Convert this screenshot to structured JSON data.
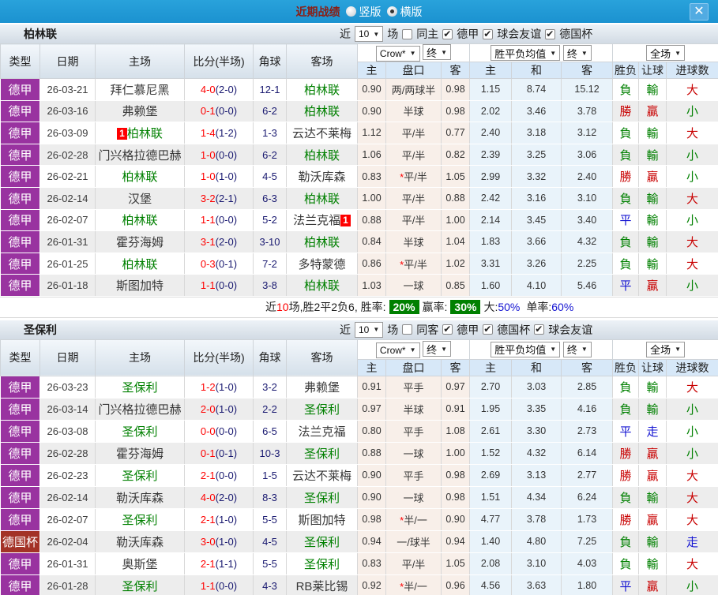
{
  "titlebar": {
    "title": "近期战绩",
    "radio_vertical": "竖版",
    "radio_horizontal": "横版",
    "close_label": "✕"
  },
  "headers": {
    "type": "类型",
    "date": "日期",
    "home": "主场",
    "score": "比分(半场)",
    "corner": "角球",
    "away": "客场",
    "asia_home": "主",
    "handicap": "盘口",
    "asia_away": "客",
    "eu_home": "主",
    "eu_draw": "和",
    "eu_away": "客",
    "result": "胜负",
    "let_ball": "让球",
    "goals": "进球数"
  },
  "dropdowns": {
    "company": "Crow*",
    "final1": "终",
    "avg": "胜平负均值",
    "final2": "终",
    "scope": "全场"
  },
  "sections": [
    {
      "team": "柏林联",
      "near_label": "近",
      "games_count": "10",
      "games_label": "场",
      "same_label": "同主",
      "filters": [
        "德甲",
        "球会友谊",
        "德国杯"
      ],
      "rows": [
        {
          "league": "德甲",
          "date": "26-03-21",
          "home": "拜仁慕尼黑",
          "home_self": false,
          "score": "4-0",
          "half": "(2-0)",
          "corner": "12-1",
          "away": "柏林联",
          "away_self": true,
          "asia_home": "0.90",
          "handicap": "两/两球半",
          "handicap_star": false,
          "asia_away": "0.98",
          "eu_home": "1.15",
          "eu_draw": "8.74",
          "eu_away": "15.12",
          "result": "負",
          "handicap_result": "輸",
          "goals_result": "大"
        },
        {
          "league": "德甲",
          "date": "26-03-16",
          "home": "弗赖堡",
          "home_self": false,
          "score": "0-1",
          "half": "(0-0)",
          "corner": "6-2",
          "away": "柏林联",
          "away_self": true,
          "asia_home": "0.90",
          "handicap": "半球",
          "handicap_star": false,
          "asia_away": "0.98",
          "eu_home": "2.02",
          "eu_draw": "3.46",
          "eu_away": "3.78",
          "result": "勝",
          "handicap_result": "贏",
          "goals_result": "小"
        },
        {
          "league": "德甲",
          "date": "26-03-09",
          "home": "柏林联",
          "home_self": true,
          "home_badge": "1",
          "score": "1-4",
          "half": "(1-2)",
          "corner": "1-3",
          "away": "云达不莱梅",
          "away_self": false,
          "asia_home": "1.12",
          "handicap": "平/半",
          "handicap_star": false,
          "asia_away": "0.77",
          "eu_home": "2.40",
          "eu_draw": "3.18",
          "eu_away": "3.12",
          "result": "負",
          "handicap_result": "輸",
          "goals_result": "大"
        },
        {
          "league": "德甲",
          "date": "26-02-28",
          "home": "门兴格拉德巴赫",
          "home_self": false,
          "score": "1-0",
          "half": "(0-0)",
          "corner": "6-2",
          "away": "柏林联",
          "away_self": true,
          "asia_home": "1.06",
          "handicap": "平/半",
          "handicap_star": false,
          "asia_away": "0.82",
          "eu_home": "2.39",
          "eu_draw": "3.25",
          "eu_away": "3.06",
          "result": "負",
          "handicap_result": "輸",
          "goals_result": "小"
        },
        {
          "league": "德甲",
          "date": "26-02-21",
          "home": "柏林联",
          "home_self": true,
          "score": "1-0",
          "half": "(1-0)",
          "corner": "4-5",
          "away": "勒沃库森",
          "away_self": false,
          "asia_home": "0.83",
          "handicap": "平/半",
          "handicap_star": true,
          "asia_away": "1.05",
          "eu_home": "2.99",
          "eu_draw": "3.32",
          "eu_away": "2.40",
          "result": "勝",
          "handicap_result": "贏",
          "goals_result": "小"
        },
        {
          "league": "德甲",
          "date": "26-02-14",
          "home": "汉堡",
          "home_self": false,
          "score": "3-2",
          "half": "(2-1)",
          "corner": "6-3",
          "away": "柏林联",
          "away_self": true,
          "asia_home": "1.00",
          "handicap": "平/半",
          "handicap_star": false,
          "asia_away": "0.88",
          "eu_home": "2.42",
          "eu_draw": "3.16",
          "eu_away": "3.10",
          "result": "負",
          "handicap_result": "輸",
          "goals_result": "大"
        },
        {
          "league": "德甲",
          "date": "26-02-07",
          "home": "柏林联",
          "home_self": true,
          "score": "1-1",
          "half": "(0-0)",
          "corner": "5-2",
          "away": "法兰克福",
          "away_self": false,
          "away_badge": "1",
          "asia_home": "0.88",
          "handicap": "平/半",
          "handicap_star": false,
          "asia_away": "1.00",
          "eu_home": "2.14",
          "eu_draw": "3.45",
          "eu_away": "3.40",
          "result": "平",
          "handicap_result": "輸",
          "goals_result": "小"
        },
        {
          "league": "德甲",
          "date": "26-01-31",
          "home": "霍芬海姆",
          "home_self": false,
          "score": "3-1",
          "half": "(2-0)",
          "corner": "3-10",
          "away": "柏林联",
          "away_self": true,
          "asia_home": "0.84",
          "handicap": "半球",
          "handicap_star": false,
          "asia_away": "1.04",
          "eu_home": "1.83",
          "eu_draw": "3.66",
          "eu_away": "4.32",
          "result": "負",
          "handicap_result": "輸",
          "goals_result": "大"
        },
        {
          "league": "德甲",
          "date": "26-01-25",
          "home": "柏林联",
          "home_self": true,
          "score": "0-3",
          "half": "(0-1)",
          "corner": "7-2",
          "away": "多特蒙德",
          "away_self": false,
          "asia_home": "0.86",
          "handicap": "平/半",
          "handicap_star": true,
          "asia_away": "1.02",
          "eu_home": "3.31",
          "eu_draw": "3.26",
          "eu_away": "2.25",
          "result": "負",
          "handicap_result": "輸",
          "goals_result": "大"
        },
        {
          "league": "德甲",
          "date": "26-01-18",
          "home": "斯图加特",
          "home_self": false,
          "score": "1-1",
          "half": "(0-0)",
          "corner": "3-8",
          "away": "柏林联",
          "away_self": true,
          "asia_home": "1.03",
          "handicap": "一球",
          "handicap_star": false,
          "asia_away": "0.85",
          "eu_home": "1.60",
          "eu_draw": "4.10",
          "eu_away": "5.46",
          "result": "平",
          "handicap_result": "贏",
          "goals_result": "小"
        }
      ],
      "summary": {
        "near": "近",
        "count": "10",
        "stats": "场,胜2平2负6, 胜率:",
        "win_pct": "20%",
        "win_label": "赢率:",
        "win2_pct": "30%",
        "big_label": "大:",
        "big_pct": "50%",
        "single_label": "单率:",
        "single_pct": "60%"
      }
    },
    {
      "team": "圣保利",
      "near_label": "近",
      "games_count": "10",
      "games_label": "场",
      "same_label": "同客",
      "filters": [
        "德甲",
        "德国杯",
        "球会友谊"
      ],
      "rows": [
        {
          "league": "德甲",
          "date": "26-03-23",
          "home": "圣保利",
          "home_self": true,
          "score": "1-2",
          "half": "(1-0)",
          "corner": "3-2",
          "away": "弗赖堡",
          "away_self": false,
          "asia_home": "0.91",
          "handicap": "平手",
          "handicap_star": false,
          "asia_away": "0.97",
          "eu_home": "2.70",
          "eu_draw": "3.03",
          "eu_away": "2.85",
          "result": "負",
          "handicap_result": "輸",
          "goals_result": "大"
        },
        {
          "league": "德甲",
          "date": "26-03-14",
          "home": "门兴格拉德巴赫",
          "home_self": false,
          "score": "2-0",
          "half": "(1-0)",
          "corner": "2-2",
          "away": "圣保利",
          "away_self": true,
          "asia_home": "0.97",
          "handicap": "半球",
          "handicap_star": false,
          "asia_away": "0.91",
          "eu_home": "1.95",
          "eu_draw": "3.35",
          "eu_away": "4.16",
          "result": "負",
          "handicap_result": "輸",
          "goals_result": "小"
        },
        {
          "league": "德甲",
          "date": "26-03-08",
          "home": "圣保利",
          "home_self": true,
          "score": "0-0",
          "half": "(0-0)",
          "corner": "6-5",
          "away": "法兰克福",
          "away_self": false,
          "asia_home": "0.80",
          "handicap": "平手",
          "handicap_star": false,
          "asia_away": "1.08",
          "eu_home": "2.61",
          "eu_draw": "3.30",
          "eu_away": "2.73",
          "result": "平",
          "handicap_result": "走",
          "goals_result": "小"
        },
        {
          "league": "德甲",
          "date": "26-02-28",
          "home": "霍芬海姆",
          "home_self": false,
          "score": "0-1",
          "half": "(0-1)",
          "corner": "10-3",
          "away": "圣保利",
          "away_self": true,
          "asia_home": "0.88",
          "handicap": "一球",
          "handicap_star": false,
          "asia_away": "1.00",
          "eu_home": "1.52",
          "eu_draw": "4.32",
          "eu_away": "6.14",
          "result": "勝",
          "handicap_result": "贏",
          "goals_result": "小"
        },
        {
          "league": "德甲",
          "date": "26-02-23",
          "home": "圣保利",
          "home_self": true,
          "score": "2-1",
          "half": "(0-0)",
          "corner": "1-5",
          "away": "云达不莱梅",
          "away_self": false,
          "asia_home": "0.90",
          "handicap": "平手",
          "handicap_star": false,
          "asia_away": "0.98",
          "eu_home": "2.69",
          "eu_draw": "3.13",
          "eu_away": "2.77",
          "result": "勝",
          "handicap_result": "贏",
          "goals_result": "大"
        },
        {
          "league": "德甲",
          "date": "26-02-14",
          "home": "勒沃库森",
          "home_self": false,
          "score": "4-0",
          "half": "(2-0)",
          "corner": "8-3",
          "away": "圣保利",
          "away_self": true,
          "asia_home": "0.90",
          "handicap": "一球",
          "handicap_star": false,
          "asia_away": "0.98",
          "eu_home": "1.51",
          "eu_draw": "4.34",
          "eu_away": "6.24",
          "result": "負",
          "handicap_result": "輸",
          "goals_result": "大"
        },
        {
          "league": "德甲",
          "date": "26-02-07",
          "home": "圣保利",
          "home_self": true,
          "score": "2-1",
          "half": "(1-0)",
          "corner": "5-5",
          "away": "斯图加特",
          "away_self": false,
          "asia_home": "0.98",
          "handicap": "半/一",
          "handicap_star": true,
          "asia_away": "0.90",
          "eu_home": "4.77",
          "eu_draw": "3.78",
          "eu_away": "1.73",
          "result": "勝",
          "handicap_result": "贏",
          "goals_result": "大"
        },
        {
          "league": "德国杯",
          "date": "26-02-04",
          "home": "勒沃库森",
          "home_self": false,
          "score": "3-0",
          "half": "(1-0)",
          "corner": "4-5",
          "away": "圣保利",
          "away_self": true,
          "asia_home": "0.94",
          "handicap": "一/球半",
          "handicap_star": false,
          "asia_away": "0.94",
          "eu_home": "1.40",
          "eu_draw": "4.80",
          "eu_away": "7.25",
          "result": "負",
          "handicap_result": "輸",
          "goals_result": "走"
        },
        {
          "league": "德甲",
          "date": "26-01-31",
          "home": "奥斯堡",
          "home_self": false,
          "score": "2-1",
          "half": "(1-1)",
          "corner": "5-5",
          "away": "圣保利",
          "away_self": true,
          "asia_home": "0.83",
          "handicap": "平/半",
          "handicap_star": false,
          "asia_away": "1.05",
          "eu_home": "2.08",
          "eu_draw": "3.10",
          "eu_away": "4.03",
          "result": "負",
          "handicap_result": "輸",
          "goals_result": "大"
        },
        {
          "league": "德甲",
          "date": "26-01-28",
          "home": "圣保利",
          "home_self": true,
          "score": "1-1",
          "half": "(0-0)",
          "corner": "4-3",
          "away": "RB莱比锡",
          "away_self": false,
          "asia_home": "0.92",
          "handicap": "半/一",
          "handicap_star": true,
          "asia_away": "0.96",
          "eu_home": "4.56",
          "eu_draw": "3.63",
          "eu_away": "1.80",
          "result": "平",
          "handicap_result": "贏",
          "goals_result": "小"
        }
      ]
    }
  ]
}
